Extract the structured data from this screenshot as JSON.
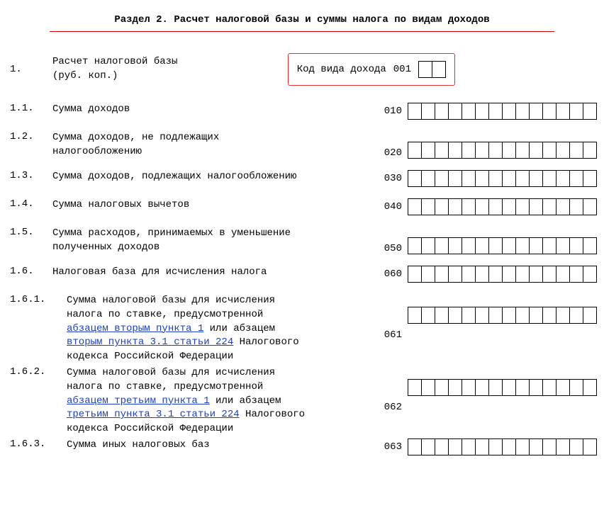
{
  "heading": "Раздел 2. Расчет налоговой базы и суммы налога по видам доходов",
  "item1": {
    "num": "1.",
    "label_l1": "Расчет налоговой базы",
    "label_l2": "(руб. коп.)",
    "box_label": "Код вида дохода",
    "box_code": "001"
  },
  "rows": {
    "r11": {
      "num": "1.1.",
      "label": "Сумма доходов",
      "code": "010"
    },
    "r12": {
      "num": "1.2.",
      "l1": "Сумма доходов, не подлежащих",
      "l2": "налогообложению",
      "code": "020"
    },
    "r13": {
      "num": "1.3.",
      "label": "Сумма доходов, подлежащих налогообложению",
      "code": "030"
    },
    "r14": {
      "num": "1.4.",
      "label": "Сумма налоговых вычетов",
      "code": "040"
    },
    "r15": {
      "num": "1.5.",
      "l1": "Сумма расходов, принимаемых в уменьшение",
      "l2": "полученных доходов",
      "code": "050"
    },
    "r16": {
      "num": "1.6.",
      "label": "Налоговая база для исчисления налога",
      "code": "060"
    },
    "r161": {
      "num": "1.6.1.",
      "l1": "Сумма налоговой базы для исчисления",
      "l2a": "налога по ставке, предусмотренной",
      "link1": "абзацем вторым пункта 1",
      "l2b": " или абзацем",
      "link2": "вторым пункта 3.1 статьи 224",
      "l3b": " Налогового",
      "l4": "кодекса Российской Федерации",
      "code": "061"
    },
    "r162": {
      "num": "1.6.2.",
      "l1": "Сумма налоговой базы для исчисления",
      "l2a": "налога по ставке, предусмотренной",
      "link1": "абзацем третьим пункта 1",
      "l2b": " или абзацем",
      "link2": "третьим пункта 3.1 статьи 224",
      "l3b": " Налогового",
      "l4": "кодекса Российской Федерации",
      "code": "062"
    },
    "r163": {
      "num": "1.6.3.",
      "label": "Сумма иных налоговых баз",
      "code": "063"
    }
  }
}
